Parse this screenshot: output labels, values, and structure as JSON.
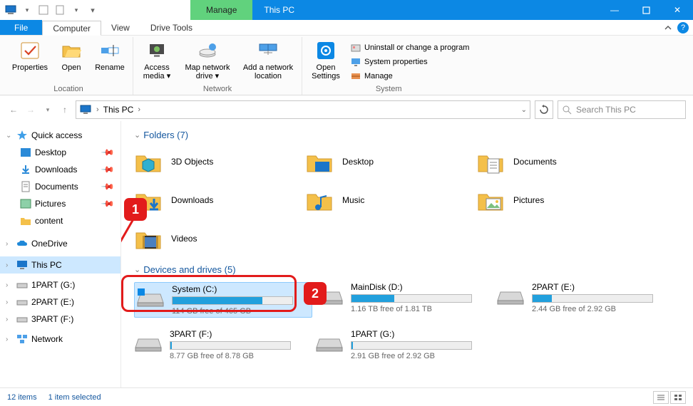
{
  "titlebar": {
    "manage": "Manage",
    "title": "This PC"
  },
  "tabs": {
    "file": "File",
    "computer": "Computer",
    "view": "View",
    "drive_tools": "Drive Tools"
  },
  "ribbon": {
    "location": {
      "label": "Location",
      "properties": "Properties",
      "open": "Open",
      "rename": "Rename"
    },
    "network": {
      "label": "Network",
      "access_media": "Access media ▾",
      "map_drive": "Map network drive ▾",
      "add_location": "Add a network location"
    },
    "open_settings": "Open Settings",
    "system": {
      "label": "System",
      "uninstall": "Uninstall or change a program",
      "properties": "System properties",
      "manage": "Manage"
    }
  },
  "address": {
    "location": "This PC",
    "search_placeholder": "Search This PC"
  },
  "nav": {
    "quick_access": "Quick access",
    "desktop": "Desktop",
    "downloads": "Downloads",
    "documents": "Documents",
    "pictures": "Pictures",
    "content": "content",
    "onedrive": "OneDrive",
    "this_pc": "This PC",
    "part_g": "1PART (G:)",
    "part_e": "2PART (E:)",
    "part_f": "3PART (F:)",
    "network": "Network"
  },
  "sections": {
    "folders": "Folders (7)",
    "drives": "Devices and drives (5)"
  },
  "folders": [
    {
      "name": "3D Objects"
    },
    {
      "name": "Desktop"
    },
    {
      "name": "Documents"
    },
    {
      "name": "Downloads"
    },
    {
      "name": "Music"
    },
    {
      "name": "Pictures"
    },
    {
      "name": "Videos"
    }
  ],
  "drives": [
    {
      "name": "System (C:)",
      "free": "114 GB free of 465 GB",
      "pct": 75,
      "selected": true,
      "os": true
    },
    {
      "name": "MainDisk (D:)",
      "free": "1.16 TB free of 1.81 TB",
      "pct": 36
    },
    {
      "name": "2PART (E:)",
      "free": "2.44 GB free of 2.92 GB",
      "pct": 16
    },
    {
      "name": "3PART (F:)",
      "free": "8.77 GB free of 8.78 GB",
      "pct": 1
    },
    {
      "name": "1PART (G:)",
      "free": "2.91 GB free of 2.92 GB",
      "pct": 1
    }
  ],
  "status": {
    "items": "12 items",
    "selected": "1 item selected"
  },
  "annotations": {
    "badge1": "1",
    "badge2": "2"
  }
}
